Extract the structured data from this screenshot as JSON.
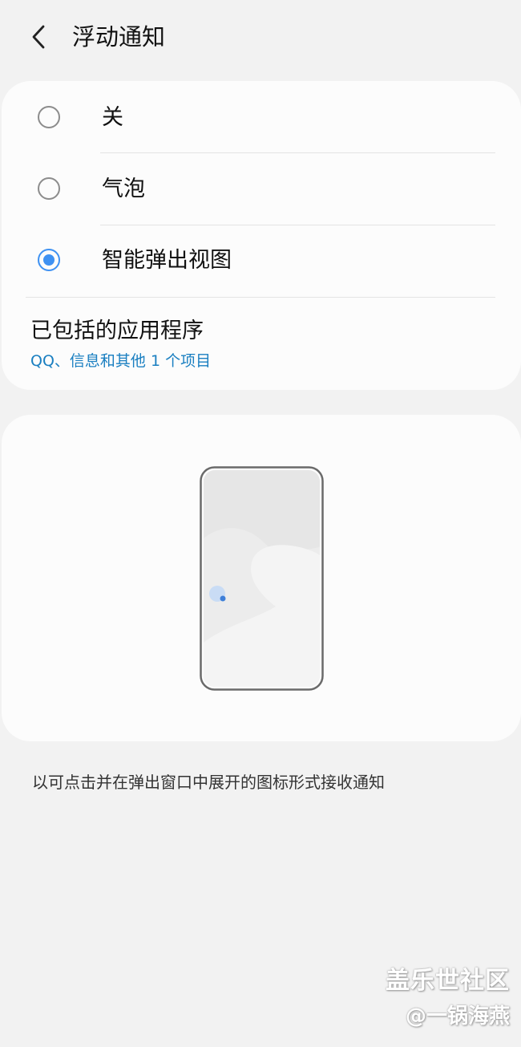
{
  "header": {
    "title": "浮动通知",
    "back_icon": "chevron-left-icon"
  },
  "options": [
    {
      "label": "关",
      "selected": false
    },
    {
      "label": "气泡",
      "selected": false
    },
    {
      "label": "智能弹出视图",
      "selected": true
    }
  ],
  "included_apps": {
    "title": "已包括的应用程序",
    "subtitle": "QQ、信息和其他 1 个项目"
  },
  "preview": {
    "illustration_icon": "phone-with-floating-bubble-icon"
  },
  "description": "以可点击并在弹出窗口中展开的图标形式接收通知",
  "watermark": {
    "line1": "盖乐世社区",
    "line2": "@一锅海燕"
  },
  "colors": {
    "background": "#f2f2f2",
    "card": "#fcfcfc",
    "accent": "#3e91f2",
    "link": "#1a7fc1"
  }
}
